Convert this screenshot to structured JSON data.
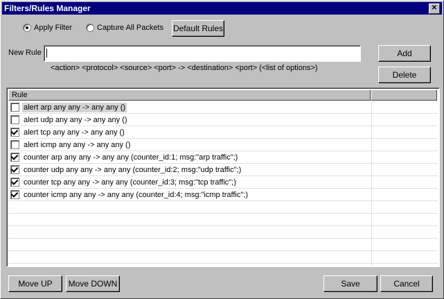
{
  "window": {
    "title": "Filters/Rules Manager"
  },
  "mode": {
    "apply_filter": "Apply Filter",
    "capture_all": "Capture All Packets",
    "default_rules": "Default Rules"
  },
  "new_rule": {
    "label": "New Rule",
    "value": "",
    "syntax_hint": "<action> <protocol> <source> <port> -> <destination> <port> (<list of options>)",
    "add": "Add",
    "delete": "Delete"
  },
  "table": {
    "header": "Rule",
    "rows": [
      {
        "text": "alert arp any any -> any any ()",
        "checked": false,
        "selected": true
      },
      {
        "text": "alert udp any any -> any any ()",
        "checked": false,
        "selected": false
      },
      {
        "text": "alert tcp any any -> any any ()",
        "checked": true,
        "selected": false
      },
      {
        "text": "alert icmp any any -> any any ()",
        "checked": false,
        "selected": false
      },
      {
        "text": "counter arp any any -> any any (counter_id:1; msg:\"arp traffic\";)",
        "checked": true,
        "selected": false
      },
      {
        "text": "counter udp any any -> any any (counter_id:2; msg:\"udp traffic\";)",
        "checked": true,
        "selected": false
      },
      {
        "text": "counter tcp any any -> any any (counter_id:3; msg:\"tcp traffic\";)",
        "checked": true,
        "selected": false
      },
      {
        "text": "counter icmp any any -> any any (counter_id:4; msg:\"icmp traffic\";)",
        "checked": true,
        "selected": false
      }
    ]
  },
  "footer": {
    "move_up": "Move UP",
    "move_down": "Move DOWN",
    "save": "Save",
    "cancel": "Cancel"
  }
}
